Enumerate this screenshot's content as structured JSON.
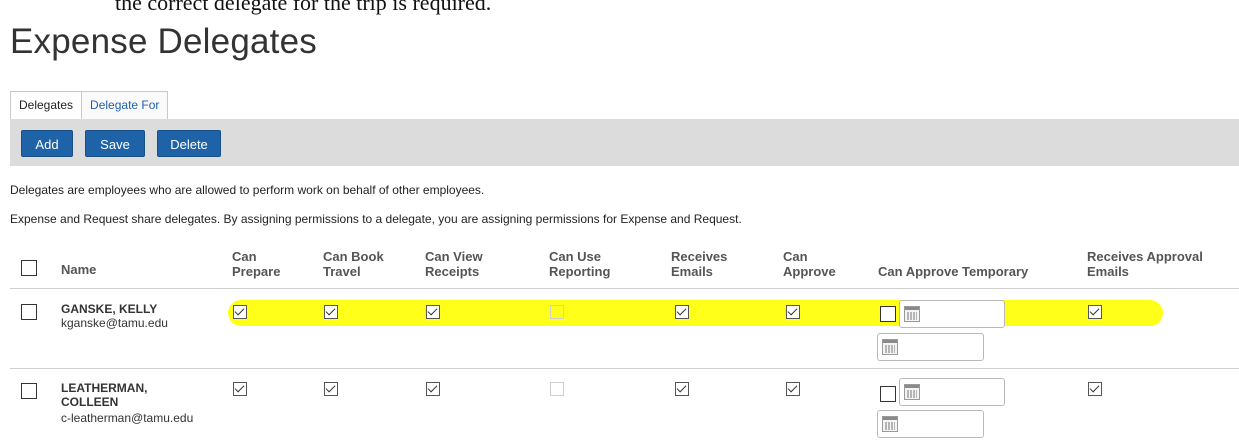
{
  "page": {
    "top_fragment": "the correct delegate for the trip is required.",
    "title": "Expense Delegates"
  },
  "tabs": [
    {
      "label": "Delegates",
      "active": true
    },
    {
      "label": "Delegate For",
      "active": false
    }
  ],
  "toolbar": {
    "add_label": "Add",
    "save_label": "Save",
    "delete_label": "Delete"
  },
  "description": {
    "line1": "Delegates are employees who are allowed to perform work on behalf of other employees.",
    "line2": "Expense and Request share delegates. By assigning permissions to a delegate, you are assigning permissions for Expense and Request."
  },
  "table": {
    "columns": {
      "name": "Name",
      "can_prepare": [
        "Can",
        "Prepare"
      ],
      "can_book_travel": [
        "Can Book",
        "Travel"
      ],
      "can_view_receipts": [
        "Can View",
        "Receipts"
      ],
      "can_use_reporting": [
        "Can Use",
        "Reporting"
      ],
      "receives_emails": [
        "Receives",
        "Emails"
      ],
      "can_approve": [
        "Can",
        "Approve"
      ],
      "can_approve_temporary": "Can Approve Temporary",
      "receives_approval_emails": [
        "Receives Approval",
        "Emails"
      ]
    },
    "rows": [
      {
        "name_line1": "GANSKE, KELLY",
        "name_line2": "",
        "email": "kganske@tamu.edu",
        "can_prepare": true,
        "can_book_travel": true,
        "can_view_receipts": true,
        "can_use_reporting": false,
        "receives_emails": true,
        "can_approve": true,
        "can_approve_temporary": false,
        "receives_approval_emails": true,
        "highlighted": true
      },
      {
        "name_line1": "LEATHERMAN,",
        "name_line2": "COLLEEN",
        "email": "c-leatherman@tamu.edu",
        "can_prepare": true,
        "can_book_travel": true,
        "can_view_receipts": true,
        "can_use_reporting": false,
        "receives_emails": true,
        "can_approve": true,
        "can_approve_temporary": false,
        "receives_approval_emails": true,
        "highlighted": false
      }
    ]
  },
  "colors": {
    "button_bg": "#1e63a8",
    "toolbar_bg": "#dcdcdc",
    "highlight": "#ffff1a",
    "tab_link": "#1f5fb0"
  }
}
